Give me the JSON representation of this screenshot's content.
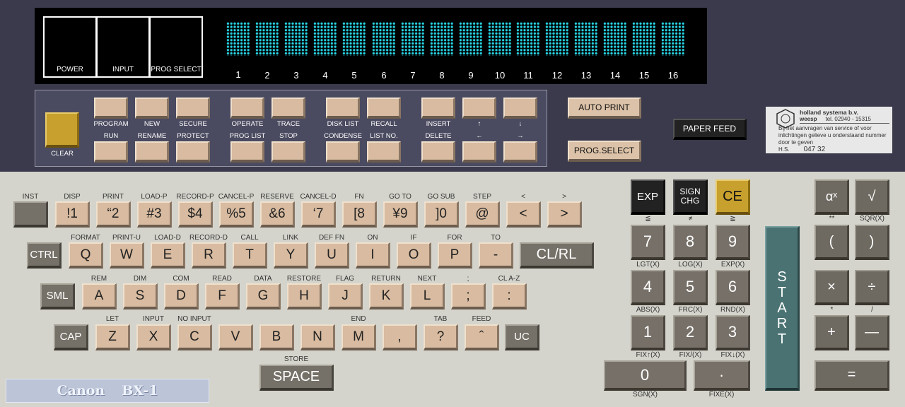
{
  "display": {
    "indicators": [
      "POWER",
      "INPUT",
      "PROG SELECT"
    ],
    "digits": [
      "1",
      "2",
      "3",
      "4",
      "5",
      "6",
      "7",
      "8",
      "9",
      "10",
      "11",
      "12",
      "13",
      "14",
      "15",
      "16"
    ]
  },
  "panel": {
    "clear": "CLEAR",
    "groups": [
      {
        "top": "PROGRAM",
        "bottom": "RUN"
      },
      {
        "top": "NEW",
        "bottom": "RENAME"
      },
      {
        "top": "SECURE",
        "bottom": "PROTECT"
      },
      {
        "top": "OPERATE",
        "bottom": "PROG LIST"
      },
      {
        "top": "TRACE",
        "bottom": "STOP"
      },
      {
        "top": "DISK LIST",
        "bottom": "CONDENSE"
      },
      {
        "top": "RECALL",
        "bottom": "LIST NO."
      },
      {
        "top": "INSERT",
        "bottom": "DELETE"
      },
      {
        "top": "↑",
        "bottom": "←"
      },
      {
        "top": "↓",
        "bottom": "→"
      }
    ]
  },
  "buttons": {
    "auto_print": "AUTO PRINT",
    "prog_select": "PROG.SELECT",
    "paper_feed": "PAPER FEED"
  },
  "note": {
    "company": "holland systema b.v.",
    "city": "weesp",
    "tel": "tel. 02940 - 15315",
    "text": "Bij het aanvragen van service of voor inlichtingen gelieve u onderstaand nummer door te geven",
    "hs": "H.S.",
    "number": "047 32"
  },
  "row1": {
    "labels": [
      "INST",
      "DISP",
      "PRINT",
      "LOAD-P",
      "RECORD-P",
      "CANCEL-P",
      "RESERVE",
      "CANCEL-D",
      "FN",
      "GO TO",
      "GO SUB",
      "STEP",
      "<",
      ">"
    ],
    "keys": [
      "",
      "!1",
      "“2",
      "#3",
      "$4",
      "%5",
      "&6",
      "‘7",
      "[8",
      "¥9",
      "]0",
      "@",
      "<",
      ">"
    ]
  },
  "row2": {
    "labels": [
      "FORMAT",
      "PRINT-U",
      "LOAD-D",
      "RECORD-D",
      "CALL",
      "LINK",
      "DEF FN",
      "ON",
      "IF",
      "FOR",
      "TO"
    ],
    "keys": [
      "CTRL",
      "Q",
      "W",
      "E",
      "R",
      "T",
      "Y",
      "U",
      "I",
      "O",
      "P",
      "-",
      "CL/RL"
    ]
  },
  "row3": {
    "labels": [
      "REM",
      "DIM",
      "COM",
      "READ",
      "DATA",
      "RESTORE",
      "FLAG",
      "RETURN",
      "NEXT",
      ";",
      "CL A-Z"
    ],
    "keys": [
      "SML",
      "A",
      "S",
      "D",
      "F",
      "G",
      "H",
      "J",
      "K",
      "L",
      ";",
      ":"
    ]
  },
  "row4": {
    "labels": [
      "LET",
      "INPUT",
      "NO INPUT",
      "END",
      "TAB",
      "FEED"
    ],
    "keys": [
      "CAP",
      "Z",
      "X",
      "C",
      "V",
      "B",
      "N",
      "M",
      ",",
      "?",
      "ˆ",
      "UC"
    ]
  },
  "space": {
    "label": "STORE",
    "key": "SPACE"
  },
  "brand": {
    "name": "Canon",
    "model": "BX-1"
  },
  "numpad": {
    "exp": "EXP",
    "sign": "SIGN CHG",
    "ce": "CE",
    "le": "≦",
    "ne": "≠",
    "ge": "≧",
    "keys": [
      "7",
      "8",
      "9",
      "4",
      "5",
      "6",
      "1",
      "2",
      "3",
      "0",
      "·"
    ],
    "labels": [
      "LGT(X)",
      "LOG(X)",
      "EXP(X)",
      "ABS(X)",
      "FRC(X)",
      "RND(X)",
      "FIX↑(X)",
      "FIX/(X)",
      "FIX↓(X)",
      "SGN(X)",
      "FIXE(X)"
    ],
    "start": "START"
  },
  "ops": {
    "pow": "αˣ",
    "sqr": "√",
    "pow_lbl": "**",
    "sqr_lbl": "SQR(X)",
    "lp": "(",
    "rp": ")",
    "mul": "×",
    "div": "÷",
    "mul_lbl": "*",
    "div_lbl": "/",
    "plus": "+",
    "minus": "—",
    "eq": "="
  }
}
